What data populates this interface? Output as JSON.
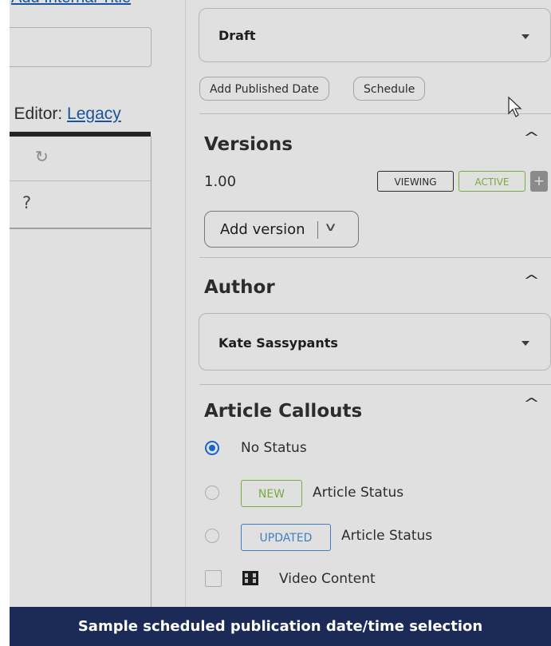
{
  "left_pane": {
    "internal_title_link": "Add Internal Title",
    "editor_label": "n Editor: ",
    "editor_link": "Legacy",
    "redo_icon": "redo-icon",
    "help_text": "?"
  },
  "status": {
    "selected": "Draft",
    "buttons": [
      "Add Published Date",
      "Schedule"
    ]
  },
  "versions": {
    "title": "Versions",
    "number": "1.00",
    "tags": [
      "VIEWING",
      "ACTIVE"
    ],
    "plus": "+",
    "add_version_label": "Add version"
  },
  "author": {
    "title": "Author",
    "selected": "Kate Sassypants"
  },
  "callouts": {
    "title": "Article Callouts",
    "options": [
      {
        "label": "No Status",
        "selected": true
      },
      {
        "pill": "NEW",
        "label": "Article Status",
        "selected": false
      },
      {
        "pill": "UPDATED",
        "label": "Article Status",
        "selected": false
      }
    ],
    "video_label": "Video Content"
  },
  "caption": "Sample scheduled publication date/time selection",
  "colors": {
    "link": "#1f5fb6",
    "active_green": "#8bc34a",
    "updated_blue": "#4a90d9",
    "radio_blue": "#1a73e8",
    "caption_bg": "#1c2a57"
  }
}
